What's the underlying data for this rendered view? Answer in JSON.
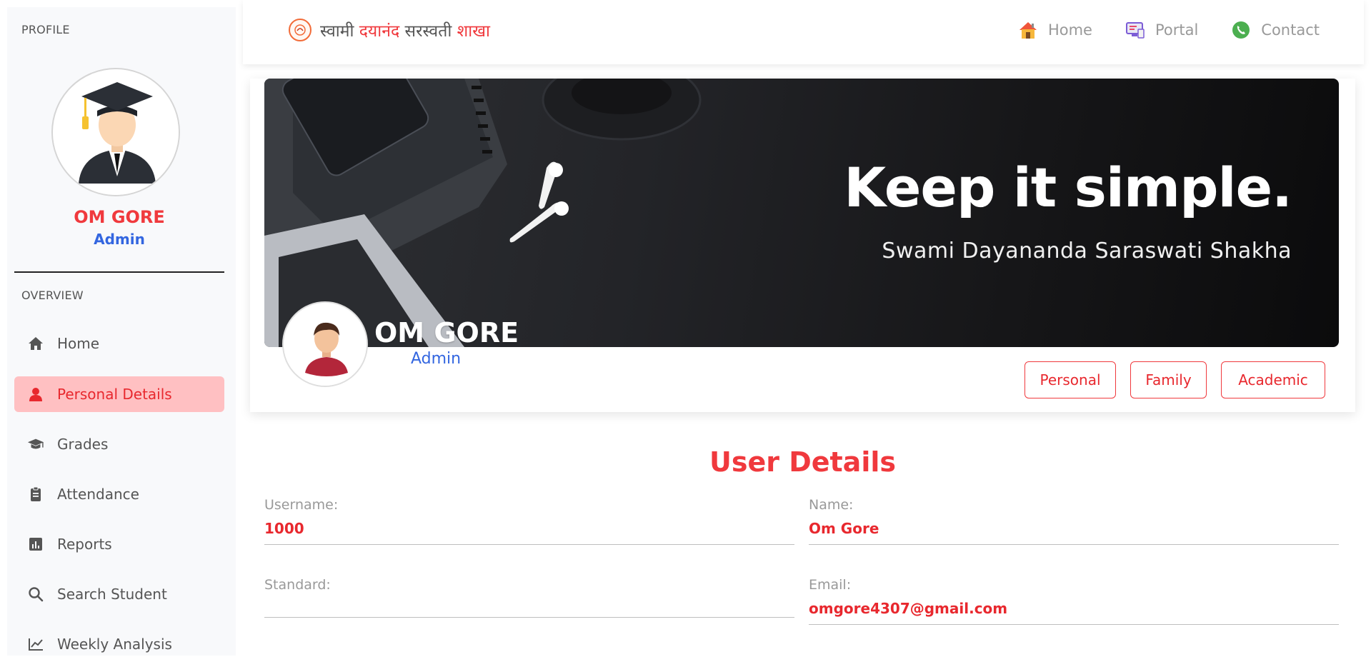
{
  "sidebar": {
    "profile_heading": "PROFILE",
    "name": "OM GORE",
    "role": "Admin",
    "overview_heading": "OVERVIEW",
    "items": [
      {
        "label": "Home",
        "icon": "home-icon"
      },
      {
        "label": "Personal Details",
        "icon": "user-icon",
        "active": true
      },
      {
        "label": "Grades",
        "icon": "graduation-cap-icon"
      },
      {
        "label": "Attendance",
        "icon": "clipboard-icon"
      },
      {
        "label": "Reports",
        "icon": "bar-chart-icon"
      },
      {
        "label": "Search Student",
        "icon": "search-icon"
      },
      {
        "label": "Weekly Analysis",
        "icon": "line-chart-icon"
      }
    ]
  },
  "topbar": {
    "brand": {
      "part1": "स्वामी ",
      "part2": "दयानंद",
      "part3": " सरस्वती ",
      "part4": "शाखा"
    },
    "links": [
      {
        "label": "Home",
        "icon": "house-icon"
      },
      {
        "label": "Portal",
        "icon": "computer-icon"
      },
      {
        "label": "Contact",
        "icon": "phone-icon"
      }
    ]
  },
  "card": {
    "banner_title": "Keep it simple.",
    "banner_subtitle": "Swami Dayananda Saraswati Shakha",
    "name": "OM GORE",
    "role": "Admin",
    "tabs": [
      "Personal",
      "Family",
      "Academic"
    ]
  },
  "user_details": {
    "title": "User Details",
    "fields": {
      "username": {
        "label": "Username:",
        "value": "1000"
      },
      "name": {
        "label": "Name:",
        "value": "Om Gore"
      },
      "standard": {
        "label": "Standard:",
        "value": ""
      },
      "email": {
        "label": "Email:",
        "value": "omgore4307@gmail.com"
      }
    }
  },
  "colors": {
    "accent_red": "#f0393d",
    "accent_blue": "#3366e0",
    "active_bg": "#ffc0c2"
  }
}
